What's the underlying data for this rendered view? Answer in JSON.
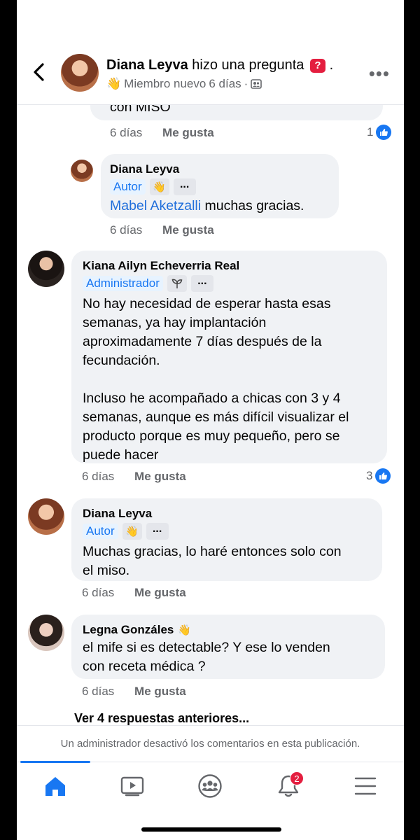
{
  "header": {
    "author": "Diana Leyva",
    "action": "hizo una pregunta",
    "question_badge": "?",
    "trailing": ".",
    "member_label": "Miembro nuevo",
    "time": "6 días",
    "separator": "·"
  },
  "comments": {
    "partial_text": "con MISO",
    "partial_time": "6 días",
    "partial_like": "Me gusta",
    "partial_reactions": "1",
    "c1": {
      "name": "Diana Leyva",
      "role": "Autor",
      "mention": "Mabel Aketzalli",
      "text": " muchas gracias.",
      "time": "6 días",
      "like": "Me gusta"
    },
    "c2": {
      "name": "Kiana Ailyn Echeverria Real",
      "role": "Administrador",
      "p1_l1": "No hay necesidad de esperar hasta esas",
      "p1_l2": "semanas, ya hay implantación",
      "p1_l3": "aproximadamente 7 días después de la",
      "p1_l4": "fecundación.",
      "p2_l1": "Incluso he acompañado a chicas con 3 y 4",
      "p2_l2": "semanas, aunque es más difícil visualizar el",
      "p2_l3": "producto porque es muy pequeño, pero se",
      "p2_l4": "puede hacer",
      "time": "6 días",
      "like": "Me gusta",
      "reactions": "3"
    },
    "c3": {
      "name": "Diana Leyva",
      "role": "Autor",
      "l1": "Muchas gracias, lo haré entonces solo con",
      "l2": "el miso.",
      "time": "6 días",
      "like": "Me gusta"
    },
    "c4": {
      "name": "Legna Gonzáles",
      "l1": "el mife si es detectable? Y ese lo venden",
      "l2": "con receta médica ?",
      "time": "6 días",
      "like": "Me gusta"
    },
    "view_previous": "Ver 4 respuestas anteriores..."
  },
  "footer_note": "Un administrador desactivó los comentarios en esta publicación.",
  "tabbar": {
    "notifications_count": "2"
  },
  "colors": {
    "accent": "#1877f2",
    "badge_red": "#e41e3f",
    "bubble": "#f0f2f5",
    "secondary_text": "#65676b"
  }
}
